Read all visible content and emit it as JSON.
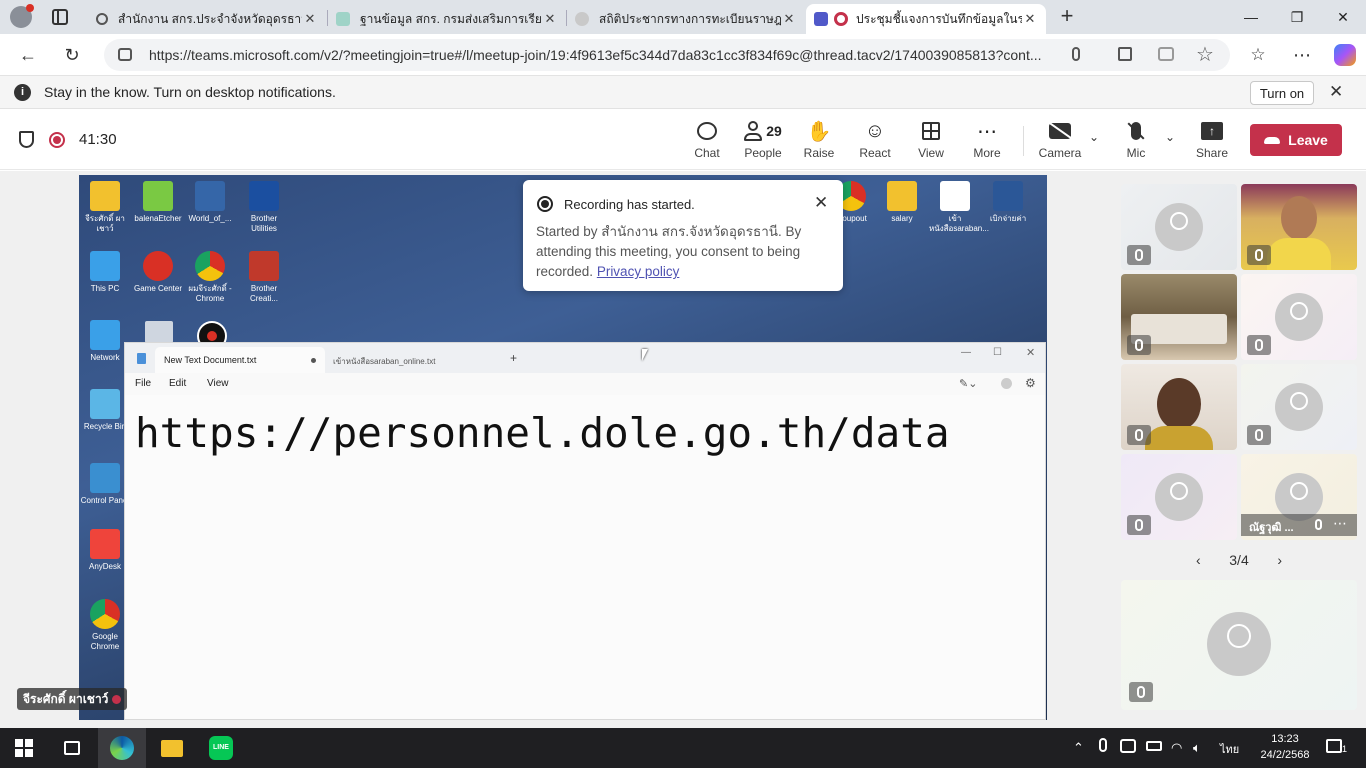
{
  "browser": {
    "tabs": [
      {
        "label": "สำนักงาน สกร.ประจำจังหวัดอุดรธานี - S",
        "active": false
      },
      {
        "label": "ฐานข้อมูล สกร. กรมส่งเสริมการเรียนรู้",
        "active": false
      },
      {
        "label": "สถิติประชากรทางการทะเบียนราษฎร",
        "active": false
      },
      {
        "label": "ประชุมชี้แจงการบันทึกข้อมูลในระบ",
        "active": true
      }
    ],
    "url": "https://teams.microsoft.com/v2/?meetingjoin=true#/l/meetup-join/19:4f9613ef5c344d7da83c1cc3f834f69c@thread.tacv2/1740039085813?cont..."
  },
  "notification_bar": {
    "message": "Stay in the know. Turn on desktop notifications.",
    "button": "Turn on"
  },
  "meeting": {
    "timer": "41:30",
    "toolbar": {
      "chat": "Chat",
      "people_count": "29",
      "people": "People",
      "raise": "Raise",
      "react": "React",
      "view": "View",
      "more": "More",
      "camera": "Camera",
      "mic": "Mic",
      "share": "Share",
      "leave": "Leave"
    },
    "recording_popup": {
      "title": "Recording has started.",
      "body": "Started by สำนักงาน สกร.จังหวัดอุดรธานี. By attending this meeting, you consent to being recorded.",
      "link": "Privacy policy"
    },
    "pager": "3/4",
    "tile_name": "ณัฐวุฒิ ...",
    "speaker_name": "จีระศักดิ์ ผาเชาว์"
  },
  "shared_screen": {
    "desktop_icons": [
      {
        "label": "จีระศักดิ์ ผาเชาว์",
        "color": "#f2c12e"
      },
      {
        "label": "balenaEtcher",
        "color": "#7ac943"
      },
      {
        "label": "World_of_...",
        "color": "#3566a8"
      },
      {
        "label": "Brother Utilities",
        "color": "#1b4fa0"
      },
      {
        "label": "This PC",
        "color": "#3aa0e8"
      },
      {
        "label": "Game Center",
        "color": "#d93025"
      },
      {
        "label": "ผมจีระศักดิ์ - Chrome",
        "color": "#e8b92d"
      },
      {
        "label": "Brother Creati...",
        "color": "#c0392b"
      },
      {
        "label": "Network",
        "color": "#3aa0e8"
      },
      {
        "label": "Recycle Bin",
        "color": "#5bb6e6"
      },
      {
        "label": "Control Panel",
        "color": "#3a8fd0"
      },
      {
        "label": "AnyDesk",
        "color": "#ef443b"
      },
      {
        "label": "Google Chrome",
        "color": "#e8b92d"
      },
      {
        "label": "groupout",
        "color": "#e8b92d"
      },
      {
        "label": "salary",
        "color": "#f2c12e"
      },
      {
        "label": "เข้า หนังสือsaraban...",
        "color": "#ffffff"
      },
      {
        "label": "เบิกจ่ายค่า",
        "color": "#2b5797"
      }
    ],
    "notepad": {
      "tab_active": "New Text Document.txt",
      "tab_inactive": "เข้าหนังสือsaraban_online.txt",
      "menu": [
        "File",
        "Edit",
        "View"
      ],
      "content": "https://personnel.dole.go.th/data"
    }
  },
  "taskbar": {
    "time": "13:23",
    "date": "24/2/2568",
    "language": "ไทย",
    "notification_count": "1"
  },
  "colors": {
    "leave": "#c4314b",
    "teams_accent": "#4f52b2"
  }
}
